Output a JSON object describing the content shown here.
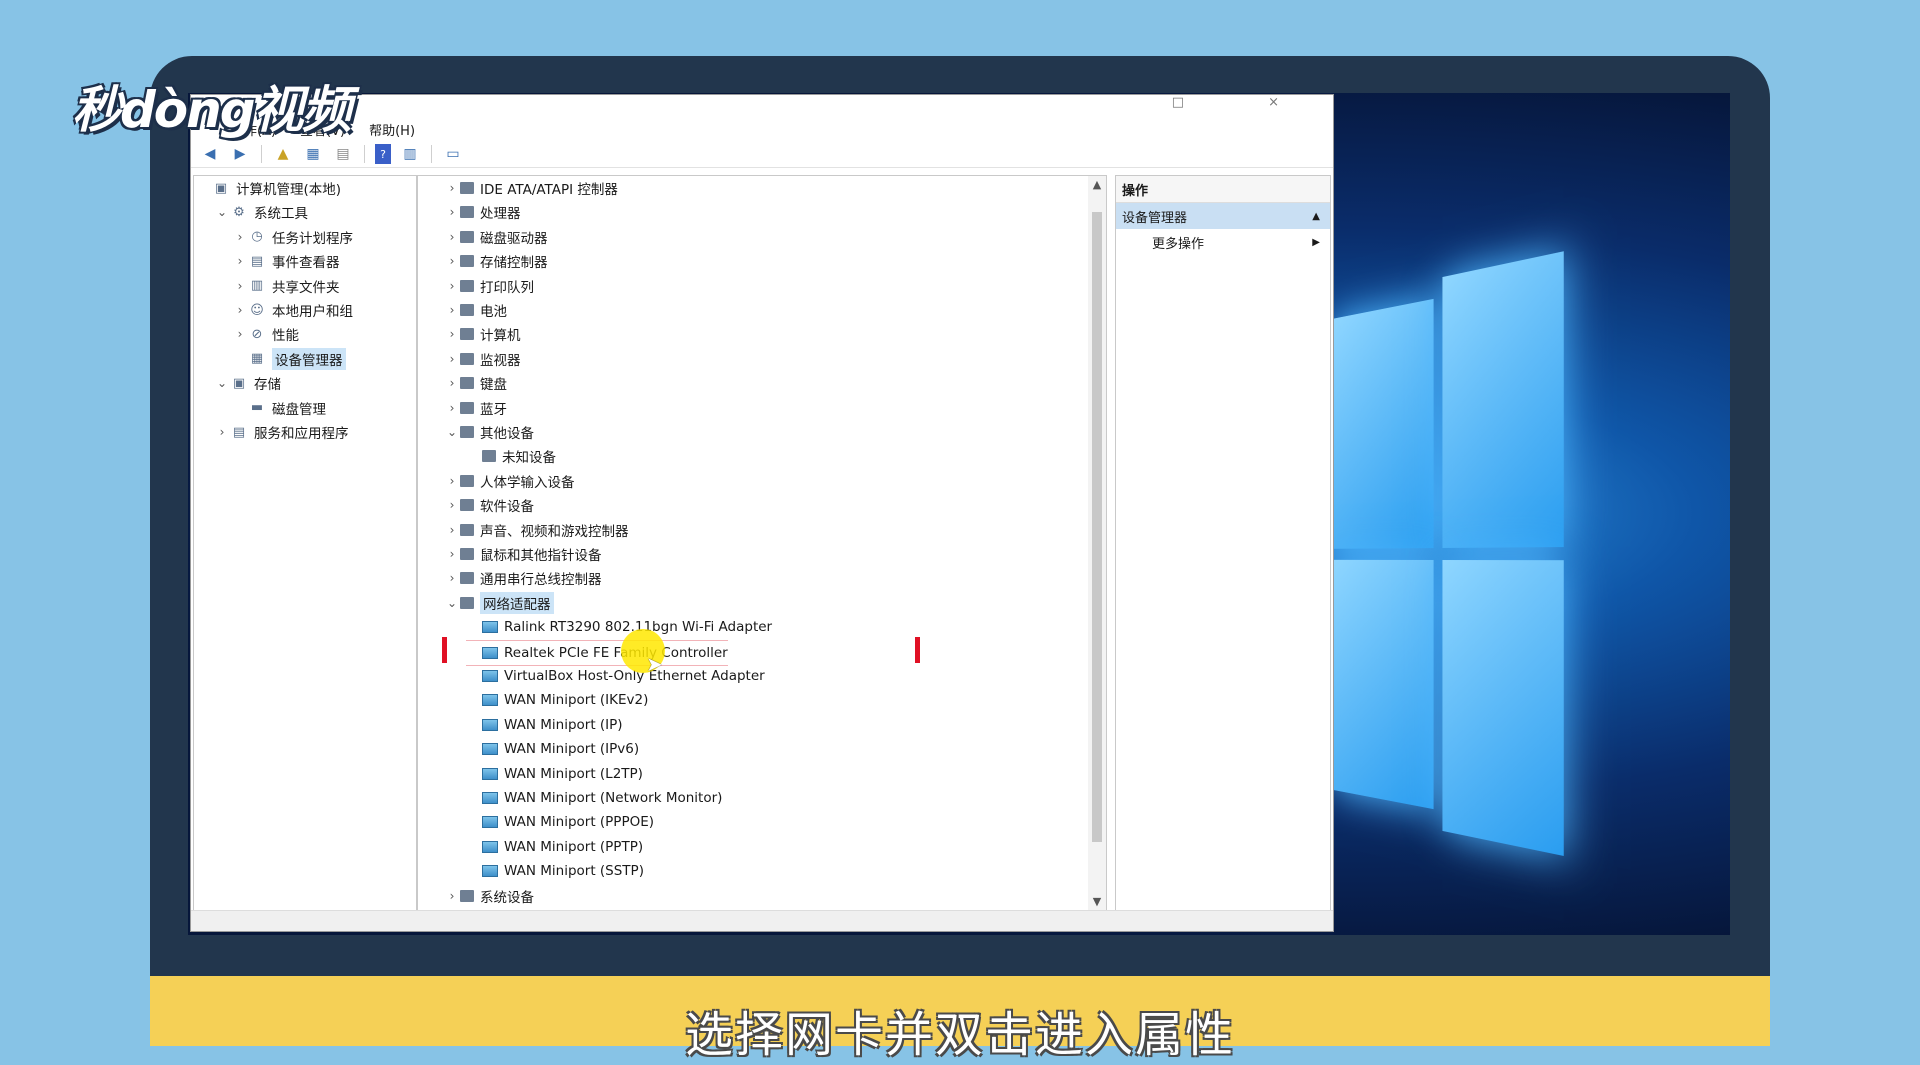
{
  "branding": {
    "logo_text": "秒dòng视频"
  },
  "caption": "选择网卡并双击进入属性",
  "window": {
    "controls": "□ ×",
    "menu": [
      "操作(A)",
      "查看(V)",
      "帮助(H)"
    ]
  },
  "left_tree": [
    {
      "label": "计算机管理(本地)",
      "expander": "",
      "level": 0
    },
    {
      "label": "系统工具",
      "expander": "⌄",
      "level": 1
    },
    {
      "label": "任务计划程序",
      "expander": "›",
      "level": 2
    },
    {
      "label": "事件查看器",
      "expander": "›",
      "level": 2
    },
    {
      "label": "共享文件夹",
      "expander": "›",
      "level": 2
    },
    {
      "label": "本地用户和组",
      "expander": "›",
      "level": 2
    },
    {
      "label": "性能",
      "expander": "›",
      "level": 2
    },
    {
      "label": "设备管理器",
      "expander": "",
      "level": 2,
      "selected": true
    },
    {
      "label": "存储",
      "expander": "⌄",
      "level": 1
    },
    {
      "label": "磁盘管理",
      "expander": "",
      "level": 2
    },
    {
      "label": "服务和应用程序",
      "expander": "›",
      "level": 1
    }
  ],
  "device_tree": [
    {
      "label": "IDE ATA/ATAPI 控制器",
      "expander": "›",
      "level": 0
    },
    {
      "label": "处理器",
      "expander": "›",
      "level": 0
    },
    {
      "label": "磁盘驱动器",
      "expander": "›",
      "level": 0
    },
    {
      "label": "存储控制器",
      "expander": "›",
      "level": 0
    },
    {
      "label": "打印队列",
      "expander": "›",
      "level": 0
    },
    {
      "label": "电池",
      "expander": "›",
      "level": 0
    },
    {
      "label": "计算机",
      "expander": "›",
      "level": 0
    },
    {
      "label": "监视器",
      "expander": "›",
      "level": 0
    },
    {
      "label": "键盘",
      "expander": "›",
      "level": 0
    },
    {
      "label": "蓝牙",
      "expander": "›",
      "level": 0
    },
    {
      "label": "其他设备",
      "expander": "⌄",
      "level": 0
    },
    {
      "label": "未知设备",
      "expander": "",
      "level": 1
    },
    {
      "label": "人体学输入设备",
      "expander": "›",
      "level": 0
    },
    {
      "label": "软件设备",
      "expander": "›",
      "level": 0
    },
    {
      "label": "声音、视频和游戏控制器",
      "expander": "›",
      "level": 0
    },
    {
      "label": "鼠标和其他指针设备",
      "expander": "›",
      "level": 0
    },
    {
      "label": "通用串行总线控制器",
      "expander": "›",
      "level": 0
    },
    {
      "label": "网络适配器",
      "expander": "⌄",
      "level": 0,
      "selected": true
    },
    {
      "label": "Ralink RT3290 802.11bgn Wi-Fi Adapter",
      "expander": "",
      "level": 1,
      "net": true
    },
    {
      "label": "Realtek PCIe FE Family Controller",
      "expander": "",
      "level": 1,
      "net": true,
      "highlight": true
    },
    {
      "label": "VirtualBox Host-Only Ethernet Adapter",
      "expander": "",
      "level": 1,
      "net": true
    },
    {
      "label": "WAN Miniport (IKEv2)",
      "expander": "",
      "level": 1,
      "net": true
    },
    {
      "label": "WAN Miniport (IP)",
      "expander": "",
      "level": 1,
      "net": true
    },
    {
      "label": "WAN Miniport (IPv6)",
      "expander": "",
      "level": 1,
      "net": true
    },
    {
      "label": "WAN Miniport (L2TP)",
      "expander": "",
      "level": 1,
      "net": true
    },
    {
      "label": "WAN Miniport (Network Monitor)",
      "expander": "",
      "level": 1,
      "net": true
    },
    {
      "label": "WAN Miniport (PPPOE)",
      "expander": "",
      "level": 1,
      "net": true
    },
    {
      "label": "WAN Miniport (PPTP)",
      "expander": "",
      "level": 1,
      "net": true
    },
    {
      "label": "WAN Miniport (SSTP)",
      "expander": "",
      "level": 1,
      "net": true
    },
    {
      "label": "系统设备",
      "expander": "›",
      "level": 0
    }
  ],
  "actions": {
    "header": "操作",
    "selected": "设备管理器",
    "more": "更多操作"
  }
}
